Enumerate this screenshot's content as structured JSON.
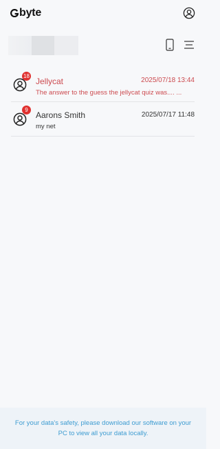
{
  "app": {
    "logo_text": "byte",
    "logo_icon": "g-logo-mark",
    "account_icon": "user-circle-icon"
  },
  "toolbar": {
    "device_icon": "phone-icon",
    "menu_icon": "menu-lines-icon"
  },
  "conversations": [
    {
      "name": "Jellycat",
      "time": "2025/07/18 13:44",
      "preview": "The answer to the guess the jellycat quiz was.... ...",
      "unread": "18",
      "highlighted": true
    },
    {
      "name": "Aarons Smith",
      "time": "2025/07/17 11:48",
      "preview": "my net",
      "unread": "9",
      "highlighted": false
    }
  ],
  "footer": {
    "notice": "For your data's safety, please download our software on your PC to view all your data locally."
  },
  "colors": {
    "unread_highlight": "#cc4a4f",
    "badge": "#e0312f",
    "footer_text": "#3e9cd1",
    "footer_bg": "#eef3f8"
  }
}
